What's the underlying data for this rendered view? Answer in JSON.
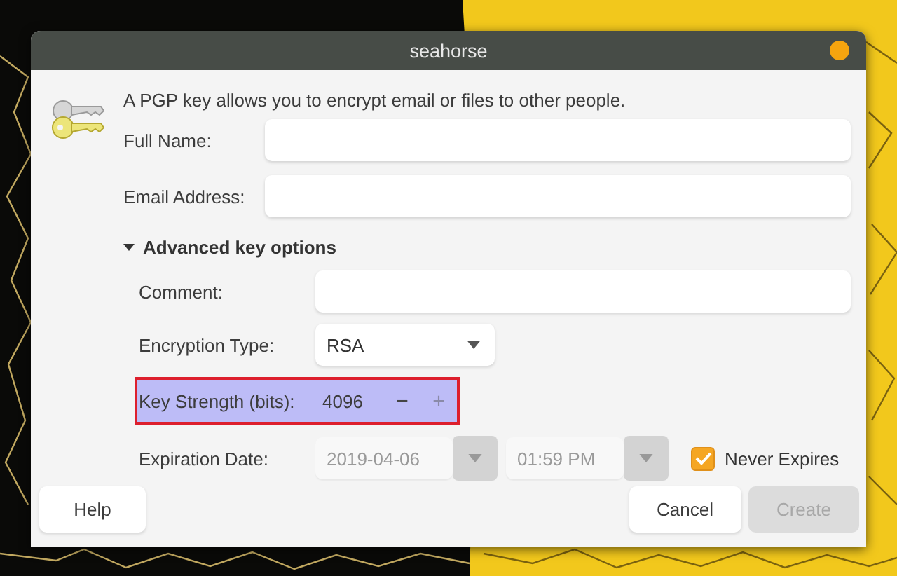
{
  "window": {
    "title": "seahorse"
  },
  "intro": "A PGP key allows you to encrypt email or files to other people.",
  "fields": [
    {
      "label": "Full Name:"
    },
    {
      "label": "Email Address:"
    }
  ],
  "advanced": {
    "label": "Advanced key options",
    "expanded": true,
    "comment": {
      "label": "Comment:"
    },
    "encryption_type": {
      "label": "Encryption Type:",
      "value": "RSA"
    },
    "key_strength": {
      "label": "Key Strength (bits):",
      "value": "4096",
      "highlighted": true,
      "spin_buttons": [
        {
          "label": "−",
          "disabled": false
        },
        {
          "label": "+",
          "disabled": true
        }
      ]
    },
    "expiration": {
      "label": "Expiration Date:",
      "date": "2019-04-06",
      "time": "01:59 PM",
      "disabled": true,
      "never_expires": {
        "label": "Never Expires",
        "checked": true
      }
    }
  },
  "buttons": [
    {
      "label": "Help",
      "kind": "help",
      "disabled": false
    },
    {
      "label": "Cancel",
      "kind": "cancel",
      "disabled": false
    },
    {
      "label": "Create",
      "kind": "create",
      "disabled": true
    }
  ]
}
